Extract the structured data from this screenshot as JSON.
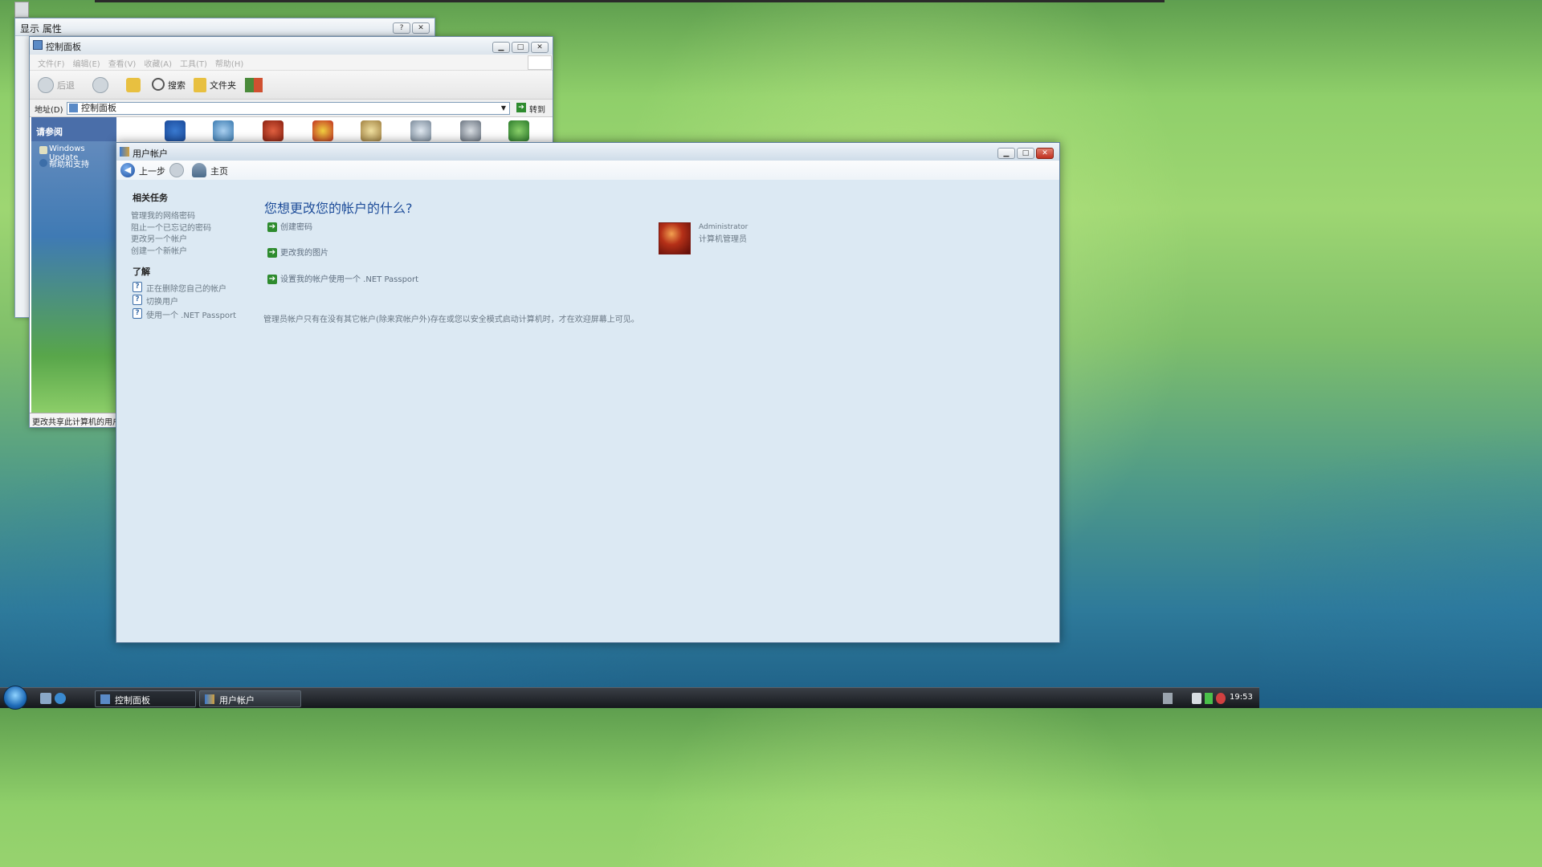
{
  "display_props": {
    "title": "显示 属性"
  },
  "control_panel": {
    "title": "控制面板",
    "menu": [
      "文件(F)",
      "编辑(E)",
      "查看(V)",
      "收藏(A)",
      "工具(T)",
      "帮助(H)"
    ],
    "toolbar": {
      "back": "后退",
      "search": "搜索",
      "folders": "文件夹"
    },
    "address_label": "地址(D)",
    "address_value": "控制面板",
    "go_label": "转到",
    "see_also_header": "请参阅",
    "see_also": [
      "Windows Update",
      "帮助和支持"
    ],
    "status": "更改共享此计算机的用户"
  },
  "user_accounts": {
    "title": "用户帐户",
    "nav": {
      "back": "上一步",
      "home": "主页"
    },
    "related_tasks_header": "相关任务",
    "related_tasks": [
      "管理我的网络密码",
      "阻止一个已忘记的密码",
      "更改另一个帐户",
      "创建一个新帐户"
    ],
    "learn_header": "了解",
    "learn_items": [
      "正在删除您自己的帐户",
      "切换用户",
      "使用一个 .NET Passport"
    ],
    "heading": "您想更改您的帐户的什么?",
    "actions": [
      "创建密码",
      "更改我的图片",
      "设置我的帐户使用一个 .NET Passport"
    ],
    "note": "管理员帐户只有在没有其它帐户(除来宾帐户外)存在或您以安全模式启动计算机时，才在欢迎屏幕上可见。",
    "account": {
      "name": "Administrator",
      "role": "计算机管理员"
    }
  },
  "taskbar": {
    "buttons": [
      "控制面板",
      "用户帐户"
    ],
    "clock": "19:53"
  },
  "colors": {
    "heading": "#1f4e9a",
    "task_arrow": "#2e8b2e"
  }
}
